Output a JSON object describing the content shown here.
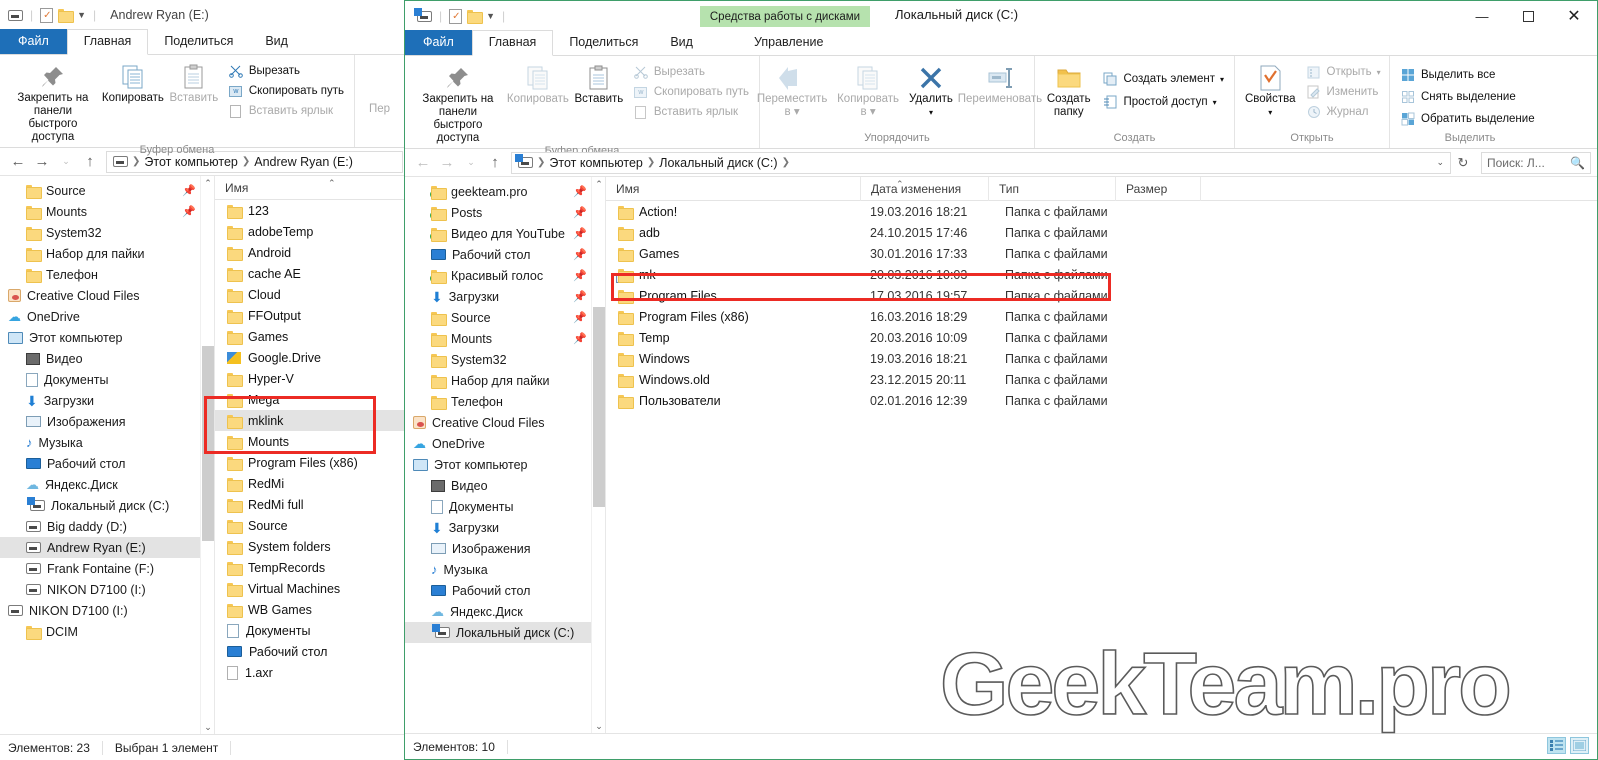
{
  "window1": {
    "title": "Andrew Ryan (E:)",
    "qat": [
      "drive-icon",
      "properties-icon",
      "new-folder-icon",
      "dropdown-icon"
    ],
    "tabs": [
      {
        "label": "Файл",
        "kind": "file"
      },
      {
        "label": "Главная",
        "kind": "active"
      },
      {
        "label": "Поделиться",
        "kind": "normal"
      },
      {
        "label": "Вид",
        "kind": "normal"
      }
    ],
    "ribbon": {
      "clipboard": {
        "pin_label": "Закрепить на панели\nбыстрого доступа",
        "pin_line1": "Закрепить на панели",
        "pin_line2": "быстрого доступа",
        "copy": "Копировать",
        "paste": "Вставить",
        "cut": "Вырезать",
        "copy_path": "Скопировать путь",
        "paste_shortcut": "Вставить ярлык",
        "group_label": "Буфер обмена"
      },
      "organize_partial": "Пер"
    },
    "address": {
      "crumbs": [
        "Этот компьютер",
        "Andrew Ryan (E:)"
      ]
    },
    "nav_items": [
      {
        "label": "Source",
        "icon": "folder",
        "indent": 1,
        "pinned": true
      },
      {
        "label": "Mounts",
        "icon": "folder",
        "indent": 1,
        "pinned": true
      },
      {
        "label": "System32",
        "icon": "folder",
        "indent": 1,
        "pinned": false
      },
      {
        "label": "Набор для пайки",
        "icon": "folder",
        "indent": 1,
        "pinned": false
      },
      {
        "label": "Телефон",
        "icon": "folder",
        "indent": 1,
        "pinned": false
      },
      {
        "label": "Creative Cloud Files",
        "icon": "creative-cloud",
        "indent": 0,
        "pinned": false
      },
      {
        "label": "OneDrive",
        "icon": "onedrive",
        "indent": 0,
        "pinned": false
      },
      {
        "label": "Этот компьютер",
        "icon": "this-pc",
        "indent": 0,
        "pinned": false
      },
      {
        "label": "Видео",
        "icon": "video",
        "indent": 1,
        "pinned": false
      },
      {
        "label": "Документы",
        "icon": "document",
        "indent": 1,
        "pinned": false
      },
      {
        "label": "Загрузки",
        "icon": "download",
        "indent": 1,
        "pinned": false
      },
      {
        "label": "Изображения",
        "icon": "picture",
        "indent": 1,
        "pinned": false
      },
      {
        "label": "Музыка",
        "icon": "music",
        "indent": 1,
        "pinned": false
      },
      {
        "label": "Рабочий стол",
        "icon": "desktop",
        "indent": 1,
        "pinned": false
      },
      {
        "label": "Яндекс.Диск",
        "icon": "yandex-disk",
        "indent": 1,
        "pinned": false
      },
      {
        "label": "Локальный диск (C:)",
        "icon": "drive-c",
        "indent": 1,
        "pinned": false
      },
      {
        "label": "Big daddy (D:)",
        "icon": "drive",
        "indent": 1,
        "pinned": false
      },
      {
        "label": "Andrew Ryan (E:)",
        "icon": "drive",
        "indent": 1,
        "pinned": false,
        "selected": true
      },
      {
        "label": "Frank Fontaine (F:)",
        "icon": "drive",
        "indent": 1,
        "pinned": false
      },
      {
        "label": "NIKON D7100 (I:)",
        "icon": "drive-plain",
        "indent": 1,
        "pinned": false
      },
      {
        "label": "NIKON D7100 (I:)",
        "icon": "drive-plain",
        "indent": 0,
        "pinned": false
      },
      {
        "label": "DCIM",
        "icon": "folder",
        "indent": 1,
        "pinned": false
      }
    ],
    "column_header": "Имя",
    "files": [
      {
        "name": "123",
        "icon": "folder"
      },
      {
        "name": "adobeTemp",
        "icon": "folder"
      },
      {
        "name": "Android",
        "icon": "folder"
      },
      {
        "name": "cache AE",
        "icon": "folder"
      },
      {
        "name": "Cloud",
        "icon": "folder"
      },
      {
        "name": "FFOutput",
        "icon": "folder"
      },
      {
        "name": "Games",
        "icon": "folder"
      },
      {
        "name": "Google.Drive",
        "icon": "google-drive"
      },
      {
        "name": "Hyper-V",
        "icon": "folder"
      },
      {
        "name": "Mega",
        "icon": "folder"
      },
      {
        "name": "mklink",
        "icon": "folder",
        "selected": true
      },
      {
        "name": "Mounts",
        "icon": "folder"
      },
      {
        "name": "Program Files (x86)",
        "icon": "folder"
      },
      {
        "name": "RedMi",
        "icon": "folder"
      },
      {
        "name": "RedMi full",
        "icon": "folder"
      },
      {
        "name": "Source",
        "icon": "folder"
      },
      {
        "name": "System folders",
        "icon": "folder"
      },
      {
        "name": "TempRecords",
        "icon": "folder"
      },
      {
        "name": "Virtual Machines",
        "icon": "folder"
      },
      {
        "name": "WB Games",
        "icon": "folder"
      },
      {
        "name": "Документы",
        "icon": "document"
      },
      {
        "name": "Рабочий стол",
        "icon": "desktop"
      },
      {
        "name": "1.axr",
        "icon": "file"
      }
    ],
    "status": {
      "count": "Элементов: 23",
      "selected": "Выбран 1 элемент"
    }
  },
  "window2": {
    "title": "Локальный диск (C:)",
    "context_tab_label": "Средства работы с дисками",
    "tabs": [
      {
        "label": "Файл",
        "kind": "file"
      },
      {
        "label": "Главная",
        "kind": "active"
      },
      {
        "label": "Поделиться",
        "kind": "normal"
      },
      {
        "label": "Вид",
        "kind": "normal"
      },
      {
        "label": "Управление",
        "kind": "context"
      }
    ],
    "window_buttons": {
      "minimize": "—",
      "maximize": "▢",
      "close": "✕"
    },
    "ribbon_collapse": "⌃",
    "help": "?",
    "ribbon": {
      "clipboard": {
        "pin_line1": "Закрепить на панели",
        "pin_line2": "быстрого доступа",
        "copy": "Копировать",
        "paste": "Вставить",
        "cut": "Вырезать",
        "copy_path": "Скопировать путь",
        "paste_shortcut": "Вставить ярлык",
        "group_label": "Буфер обмена"
      },
      "organize": {
        "move_to_l1": "Переместить",
        "move_to_l2": "в",
        "copy_to_l1": "Копировать",
        "copy_to_l2": "в",
        "delete": "Удалить",
        "rename": "Переименовать",
        "group_label": "Упорядочить"
      },
      "new": {
        "new_folder_l1": "Создать",
        "new_folder_l2": "папку",
        "new_item": "Создать элемент",
        "easy_access": "Простой доступ",
        "group_label": "Создать"
      },
      "open": {
        "properties": "Свойства",
        "open": "Открыть",
        "edit": "Изменить",
        "history": "Журнал",
        "group_label": "Открыть"
      },
      "select": {
        "select_all": "Выделить все",
        "select_none": "Снять выделение",
        "invert": "Обратить выделение",
        "group_label": "Выделить"
      }
    },
    "address": {
      "crumbs": [
        "Этот компьютер",
        "Локальный диск (C:)"
      ],
      "refresh_icon": "refresh-icon",
      "search_placeholder": "Поиск: Л..."
    },
    "nav_items": [
      {
        "label": "geekteam.pro",
        "icon": "folder-sync",
        "indent": 1,
        "pinned": true
      },
      {
        "label": "Posts",
        "icon": "folder-sync",
        "indent": 1,
        "pinned": true
      },
      {
        "label": "Видео для YouTube",
        "icon": "folder-sync",
        "indent": 1,
        "pinned": true
      },
      {
        "label": "Рабочий стол",
        "icon": "desktop",
        "indent": 1,
        "pinned": true
      },
      {
        "label": "Красивый голос",
        "icon": "folder-sync",
        "indent": 1,
        "pinned": true
      },
      {
        "label": "Загрузки",
        "icon": "download",
        "indent": 1,
        "pinned": true
      },
      {
        "label": "Source",
        "icon": "folder",
        "indent": 1,
        "pinned": true
      },
      {
        "label": "Mounts",
        "icon": "folder",
        "indent": 1,
        "pinned": true
      },
      {
        "label": "System32",
        "icon": "folder",
        "indent": 1,
        "pinned": false
      },
      {
        "label": "Набор для пайки",
        "icon": "folder",
        "indent": 1,
        "pinned": false
      },
      {
        "label": "Телефон",
        "icon": "folder",
        "indent": 1,
        "pinned": false
      },
      {
        "label": "Creative Cloud Files",
        "icon": "creative-cloud",
        "indent": 0,
        "pinned": false
      },
      {
        "label": "OneDrive",
        "icon": "onedrive",
        "indent": 0,
        "pinned": false
      },
      {
        "label": "Этот компьютер",
        "icon": "this-pc",
        "indent": 0,
        "pinned": false
      },
      {
        "label": "Видео",
        "icon": "video",
        "indent": 1,
        "pinned": false
      },
      {
        "label": "Документы",
        "icon": "document",
        "indent": 1,
        "pinned": false
      },
      {
        "label": "Загрузки",
        "icon": "download",
        "indent": 1,
        "pinned": false
      },
      {
        "label": "Изображения",
        "icon": "picture",
        "indent": 1,
        "pinned": false
      },
      {
        "label": "Музыка",
        "icon": "music",
        "indent": 1,
        "pinned": false
      },
      {
        "label": "Рабочий стол",
        "icon": "desktop",
        "indent": 1,
        "pinned": false
      },
      {
        "label": "Яндекс.Диск",
        "icon": "yandex-disk",
        "indent": 1,
        "pinned": false
      },
      {
        "label": "Локальный диск (C:)",
        "icon": "drive-c",
        "indent": 1,
        "pinned": false,
        "selected": true
      }
    ],
    "columns": [
      "Имя",
      "Дата изменения",
      "Тип",
      "Размер"
    ],
    "files": [
      {
        "name": "Action!",
        "date": "19.03.2016 18:21",
        "type": "Папка с файлами",
        "size": ""
      },
      {
        "name": "adb",
        "date": "24.10.2015 17:46",
        "type": "Папка с файлами",
        "size": ""
      },
      {
        "name": "Games",
        "date": "30.01.2016 17:33",
        "type": "Папка с файлами",
        "size": ""
      },
      {
        "name": "mk",
        "date": "20.03.2016 10:03",
        "type": "Папка с файлами",
        "size": "",
        "link": true,
        "highlighted": true
      },
      {
        "name": "Program Files",
        "date": "17.03.2016 19:57",
        "type": "Папка с файлами",
        "size": ""
      },
      {
        "name": "Program Files (x86)",
        "date": "16.03.2016 18:29",
        "type": "Папка с файлами",
        "size": ""
      },
      {
        "name": "Temp",
        "date": "20.03.2016 10:09",
        "type": "Папка с файлами",
        "size": ""
      },
      {
        "name": "Windows",
        "date": "19.03.2016 18:21",
        "type": "Папка с файлами",
        "size": ""
      },
      {
        "name": "Windows.old",
        "date": "23.12.2015 20:11",
        "type": "Папка с файлами",
        "size": ""
      },
      {
        "name": "Пользователи",
        "date": "02.01.2016 12:39",
        "type": "Папка с файлами",
        "size": ""
      }
    ],
    "status": {
      "count": "Элементов: 10"
    },
    "view_buttons": [
      "details-view-icon",
      "large-icons-view-icon"
    ]
  },
  "watermark": "GeekTeam.pro",
  "colors": {
    "accent": "#1e6fb8",
    "context_tab": "#b6e2ae",
    "highlight_box": "#ec2b24",
    "window_border": "#3f9e6a",
    "selection": "#e3e3e3"
  }
}
